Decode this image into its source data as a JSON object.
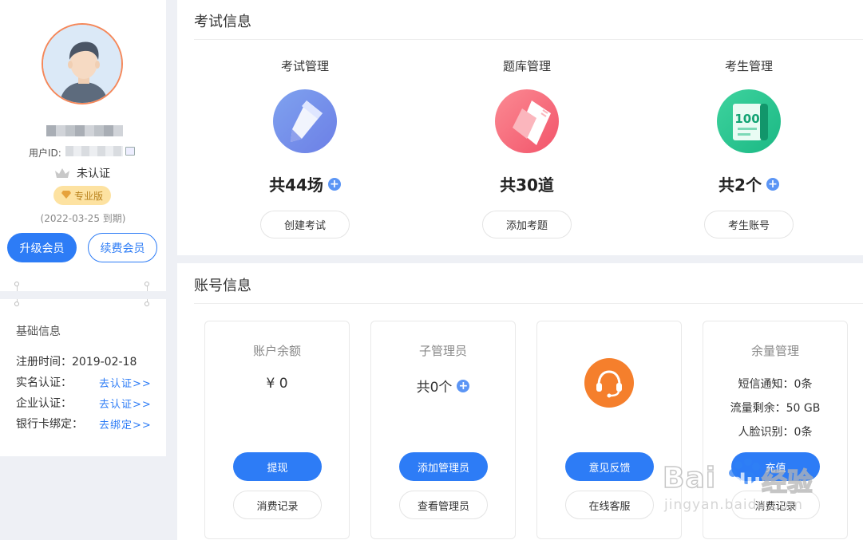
{
  "profile": {
    "user_id_label": "用户ID:",
    "auth_status": "未认证",
    "edition_badge": "专业版",
    "expiry": "(2022-03-25 到期)",
    "upgrade_label": "升级会员",
    "renew_label": "续费会员"
  },
  "basic_info": {
    "title": "基础信息",
    "register_label": "注册时间：",
    "register_value": "2019-02-18",
    "realname_label": "实名认证：",
    "realname_link": "去认证>>",
    "enterprise_label": "企业认证：",
    "enterprise_link": "去认证>>",
    "bank_label": "银行卡绑定：",
    "bank_link": "去绑定>>"
  },
  "exam_section": {
    "title": "考试信息",
    "columns": [
      {
        "label": "考试管理",
        "count": "共44场",
        "button": "创建考试",
        "has_plus": true
      },
      {
        "label": "题库管理",
        "count": "共30道",
        "button": "添加考题",
        "has_plus": false
      },
      {
        "label": "考生管理",
        "count": "共2个",
        "button": "考生账号",
        "has_plus": true
      }
    ]
  },
  "account_section": {
    "title": "账号信息",
    "balance": {
      "title": "账户余额",
      "value": "¥ 0",
      "primary": "提现",
      "secondary": "消费记录"
    },
    "sub_admin": {
      "title": "子管理员",
      "value": "共0个",
      "primary": "添加管理员",
      "secondary": "查看管理员"
    },
    "feedback": {
      "primary": "意见反馈",
      "secondary": "在线客服"
    },
    "quota": {
      "title": "余量管理",
      "sms": "短信通知：0条",
      "traffic": "流量剩余：50 GB",
      "face": "人脸识别：0条",
      "primary": "充值",
      "secondary": "消费记录"
    }
  },
  "watermark": {
    "text1": "Bai",
    "text2": "经验",
    "url": "jingyan.baidu.com"
  },
  "colors": {
    "primary": "#2d7cf6",
    "orange": "#f57f2c",
    "badge": "#fde2a1"
  }
}
